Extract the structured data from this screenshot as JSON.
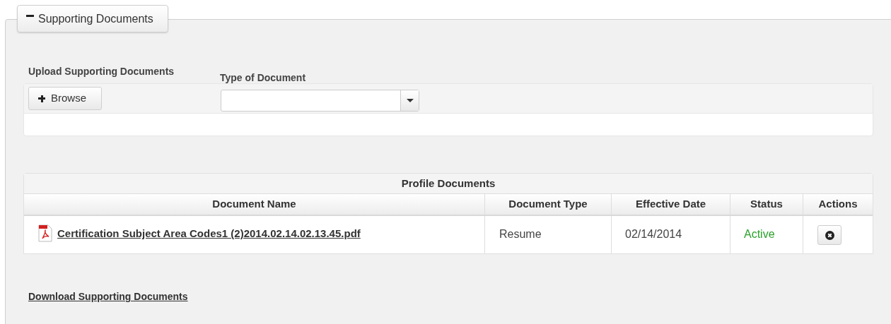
{
  "section": {
    "title": "Supporting Documents",
    "expanded": true
  },
  "upload": {
    "label": "Upload Supporting Documents",
    "browse_button": "Browse",
    "type_label": "Type of Document"
  },
  "table": {
    "caption": "Profile Documents",
    "columns": [
      "Document Name",
      "Document Type",
      "Effective Date",
      "Status",
      "Actions"
    ],
    "rows": [
      {
        "name": "Certification Subject Area Codes1 (2)2014.02.14.02.13.45.pdf",
        "type": "Resume",
        "date": "02/14/2014",
        "status": "Active"
      }
    ]
  },
  "download_link": "Download Supporting Documents"
}
